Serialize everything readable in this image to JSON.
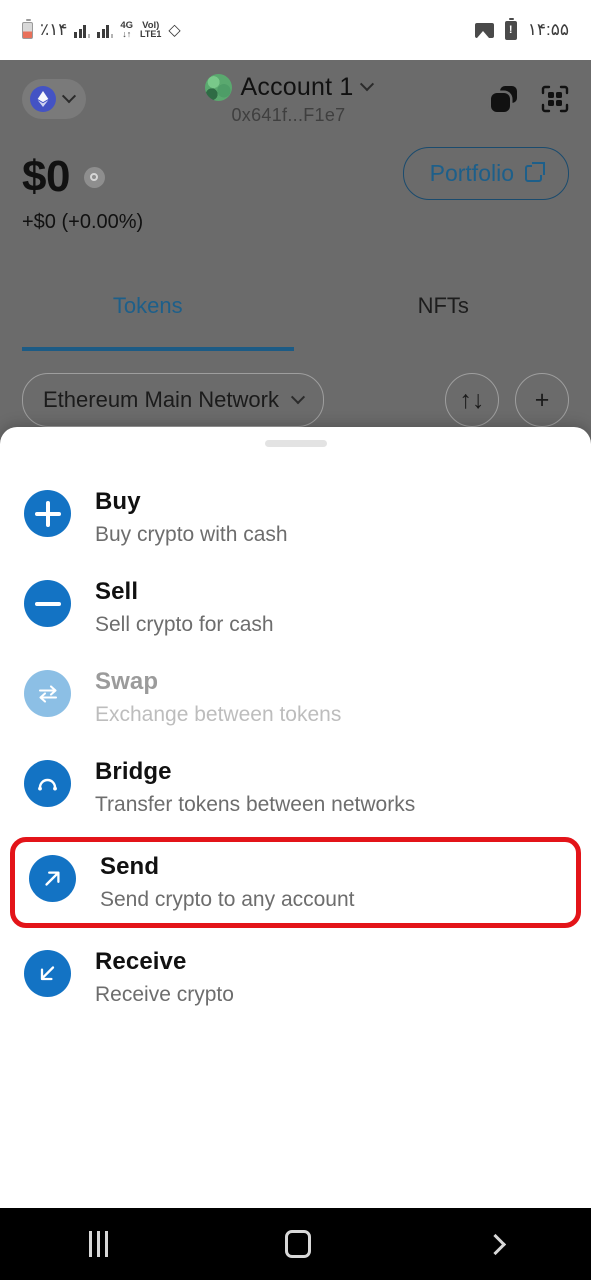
{
  "status_bar": {
    "battery_percent": "٪۱۴",
    "network_tech": "4G",
    "network_sub": "↓↑",
    "volte_top": "Vol)",
    "volte_bottom": "LTE1",
    "bluetooth_icon": "bluetooth-icon",
    "image_icon": "image-icon",
    "battery_alert_icon": "battery-alert-icon",
    "time": "۱۴:۵۵"
  },
  "wallet": {
    "network_pill": {
      "icon": "ethereum-icon",
      "chevron": "chevron-down-icon"
    },
    "account": {
      "name": "Account 1",
      "address": "0x641f...F1e7",
      "avatar": "account-avatar",
      "chevron": "chevron-down-icon"
    },
    "top_actions": [
      {
        "name": "copy-address-icon",
        "label": "copy"
      },
      {
        "name": "qr-scan-icon",
        "label": "scan"
      }
    ],
    "balance": {
      "amount": "$0",
      "change": "+$0 (+0.00%)",
      "eye_icon": "eye-hide-icon"
    },
    "portfolio_button": {
      "label": "Portfolio",
      "icon": "external-link-icon"
    },
    "tabs": [
      {
        "label": "Tokens",
        "active": true
      },
      {
        "label": "NFTs",
        "active": false
      }
    ],
    "network_chip": {
      "label": "Ethereum Main Network",
      "chevron": "chevron-down-icon"
    },
    "sort_button": {
      "icon": "sort-arrows-icon",
      "glyph": "↑↓"
    },
    "add_button": {
      "icon": "plus-icon",
      "glyph": "+"
    }
  },
  "action_sheet": {
    "handle": "drag-handle",
    "options": [
      {
        "title": "Buy",
        "subtitle": "Buy crypto with cash",
        "icon": "plus-circle-icon",
        "disabled": false,
        "highlighted": false
      },
      {
        "title": "Sell",
        "subtitle": "Sell crypto for cash",
        "icon": "minus-circle-icon",
        "disabled": false,
        "highlighted": false
      },
      {
        "title": "Swap",
        "subtitle": "Exchange between tokens",
        "icon": "swap-arrows-icon",
        "disabled": true,
        "highlighted": false
      },
      {
        "title": "Bridge",
        "subtitle": "Transfer tokens between networks",
        "icon": "bridge-arch-icon",
        "disabled": false,
        "highlighted": false
      },
      {
        "title": "Send",
        "subtitle": "Send crypto to any account",
        "icon": "arrow-up-right-icon",
        "disabled": false,
        "highlighted": true
      },
      {
        "title": "Receive",
        "subtitle": "Receive crypto",
        "icon": "arrow-down-left-icon",
        "disabled": false,
        "highlighted": false
      }
    ]
  },
  "nav_bar": {
    "recents": "recents-icon",
    "home": "home-icon",
    "back": "back-icon"
  },
  "colors": {
    "accent_blue": "#1373c4",
    "accent_blue_disabled": "#8cbfe5",
    "highlight_red": "#e31419",
    "link_blue": "#1d5f8a",
    "scrim": "#6b6b6b"
  }
}
